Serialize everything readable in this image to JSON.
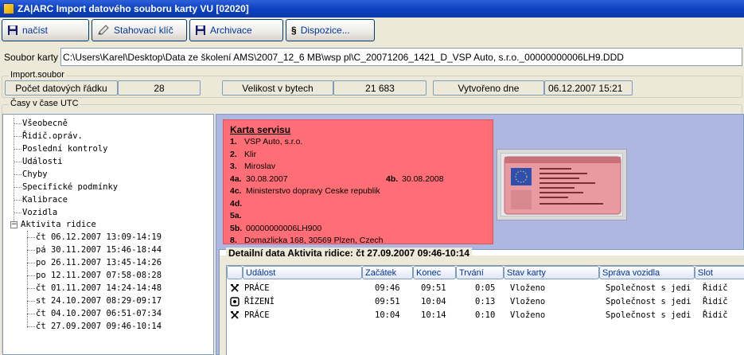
{
  "window": {
    "title": "ZA|ARC Import datového souboru karty VU [02020]"
  },
  "toolbar": {
    "buttons": [
      {
        "label": "načíst",
        "icon": "floppy-disk-icon"
      },
      {
        "label": "Stahovací klíč",
        "icon": "pen-icon"
      },
      {
        "label": "Archivace",
        "icon": "floppy-disk-icon"
      },
      {
        "label": "Dispozice...",
        "icon": "section-sign-icon"
      }
    ]
  },
  "file": {
    "label": "Soubor karty",
    "path": "C:\\Users\\Karel\\Desktop\\Data ze školení AMS\\2007_12_6 MB\\wsp pl\\C_20071206_1421_D_VSP Auto, s.r.o._00000000006LH9.DDD"
  },
  "import": {
    "group_title": "Import.soubor",
    "rows_label": "Počet datových řádku",
    "rows_value": "28",
    "size_label": "Velikost v bytech",
    "size_value": "21 683",
    "created_label": "Vytvořeno dne",
    "created_value": "06.12.2007 15:21"
  },
  "times": {
    "group_title": "Časy v čase UTC"
  },
  "tree": {
    "items": [
      "Všeobecně",
      "Řidič.opráv.",
      "Poslední kontroly",
      "Události",
      "Chyby",
      "Specifické podmínky",
      "Kalibrace",
      "Vozidla"
    ],
    "activity": {
      "label": "Aktivita ridice",
      "expander": "−",
      "children": [
        "čt 06.12.2007 13:09-14:19",
        "pá 30.11.2007 15:46-18:44",
        "po 26.11.2007 13:45-14:26",
        "po 12.11.2007 07:58-08:28",
        "čt 01.11.2007 14:24-14:48",
        "st 24.10.2007 08:29-09:17",
        "čt 04.10.2007 06:51-07:34",
        "čt 27.09.2007 09:46-10:14"
      ]
    }
  },
  "card": {
    "title": "Karta servisu",
    "f1_key": "1.",
    "f1": "VSP Auto, s.r.o.",
    "f2_key": "2.",
    "f2": "Klir",
    "f3_key": "3.",
    "f3": "Miroslav",
    "f4a_key": "4a.",
    "f4a": "30.08.2007",
    "f4b_key": "4b.",
    "f4b": "30.08.2008",
    "f4c_key": "4c.",
    "f4c": "Ministerstvo dopravy Ceske republik",
    "f4d_key": "4d.",
    "f4d": "",
    "f5a_key": "5a.",
    "f5a": "",
    "f5b_key": "5b.",
    "f5b": "00000000006LH900",
    "f8_key": "8.",
    "f8": "Domazlicka 168, 30569 Plzen, Czech"
  },
  "detail": {
    "title": "Detailní data Aktivita ridice: čt 27.09.2007 09:46-10:14",
    "columns": [
      "",
      "Událost",
      "Začátek",
      "Konec",
      "Trvání",
      "Stav karty",
      "Správa vozidla",
      "Slot"
    ],
    "rows": [
      {
        "icon": "crossed-hammers-icon",
        "event": "PRÁCE",
        "start": "09:46",
        "end": "09:51",
        "duration": "0:05",
        "card_state": "Vloženo",
        "vehicle": "Společnost s jedi",
        "slot": "Řidič"
      },
      {
        "icon": "steering-wheel-icon",
        "event": "ŘÍZENÍ",
        "start": "09:51",
        "end": "10:04",
        "duration": "0:13",
        "card_state": "Vloženo",
        "vehicle": "Společnost s jedi",
        "slot": "Řidič"
      },
      {
        "icon": "crossed-hammers-icon",
        "event": "PRÁCE",
        "start": "10:04",
        "end": "10:14",
        "duration": "0:10",
        "card_state": "Vloženo",
        "vehicle": "Společnost s jedi",
        "slot": "Řidič"
      }
    ]
  }
}
